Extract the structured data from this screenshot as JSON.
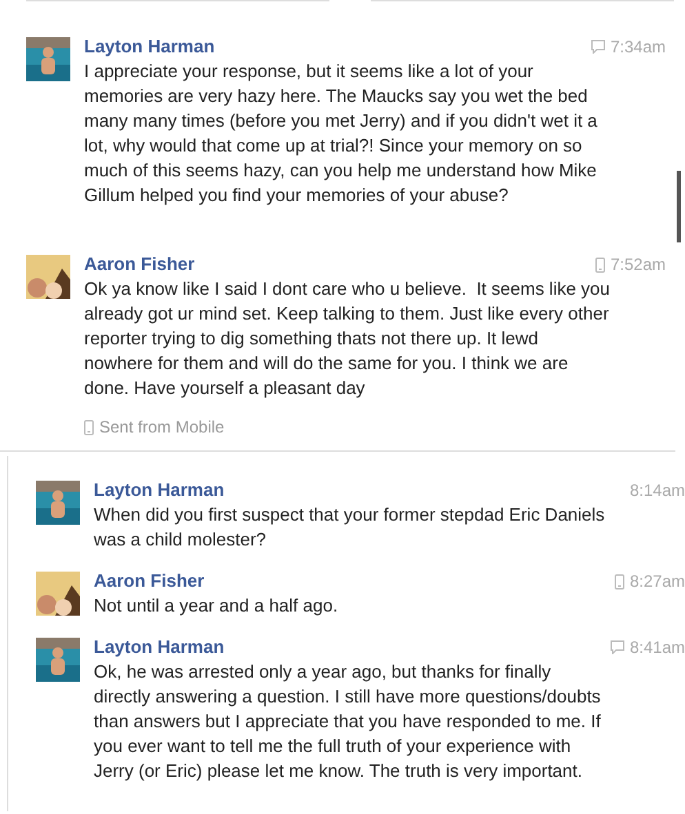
{
  "sections": [
    {
      "messages": [
        {
          "sender": "Layton Harman",
          "time": "7:34am",
          "kind": "web",
          "text": "I appreciate your response, but it seems like a lot of your memories are very hazy here. The Maucks say you wet the bed many many times (before you met Jerry) and if you didn't wet it a lot, why would that come up at trial?! Since your memory on so much of this seems hazy, can you help me understand how Mike Gillum helped you find your memories of your abuse?"
        },
        {
          "sender": "Aaron Fisher",
          "time": "7:52am",
          "kind": "mobile",
          "text": "Ok ya know like I said I dont care who u believe.  It seems like you already got ur mind set. Keep talking to them. Just like every other reporter trying to dig something thats not there up. It lewd nowhere for them and will do the same for you. I think we are done. Have yourself a pleasant day",
          "note": "Sent from Mobile"
        }
      ]
    },
    {
      "messages": [
        {
          "sender": "Layton Harman",
          "time": "8:14am",
          "kind": "plain",
          "text": "When did you first suspect that your former stepdad Eric Daniels was a child molester?"
        },
        {
          "sender": "Aaron Fisher",
          "time": "8:27am",
          "kind": "mobile",
          "text": "Not until a year and a half ago."
        },
        {
          "sender": "Layton Harman",
          "time": "8:41am",
          "kind": "web",
          "text": "Ok, he was arrested only a year ago, but thanks for finally directly answering a question. I still have more questions/doubts than answers but I appreciate that you have responded to me. If you ever want to tell me the full truth of your experience with Jerry (or Eric) please let me know. The truth is very important."
        }
      ]
    }
  ]
}
